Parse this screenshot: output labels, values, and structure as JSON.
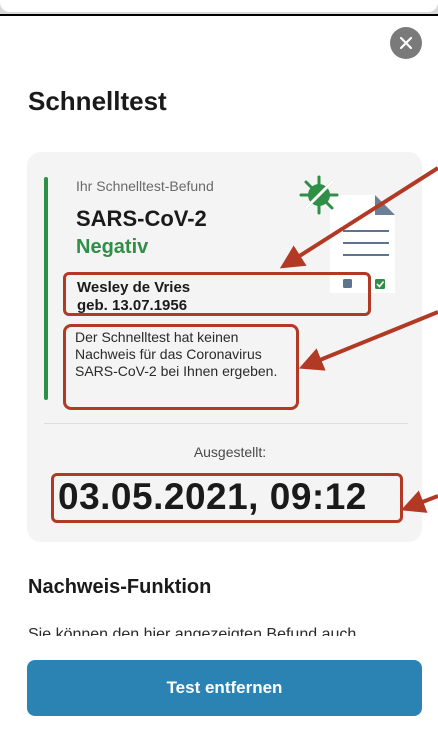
{
  "header": {
    "title": "Schnelltest",
    "close_icon": "close-icon"
  },
  "result_card": {
    "label": "Ihr Schnelltest-Befund",
    "virus": "SARS-CoV-2",
    "result": "Negativ",
    "person_name": "Wesley de Vries",
    "person_dob": "geb. 13.07.1956",
    "description": "Der Schnelltest hat keinen Nachweis für das Coronavirus SARS-CoV-2 bei Ihnen ergeben.",
    "issued_label": "Ausgestellt:",
    "issued_datetime": "03.05.2021, 09:12",
    "illustration_icon": "virus-document-icon"
  },
  "section": {
    "title": "Nachweis-Funktion",
    "text": "Sie können den hier angezeigten Befund auch"
  },
  "actions": {
    "remove_label": "Test entfernen"
  },
  "colors": {
    "accent_blue": "#2b83b4",
    "negative_green": "#2f8f46",
    "highlight_red": "#b23a24",
    "card_bg": "#f4f4f4"
  }
}
